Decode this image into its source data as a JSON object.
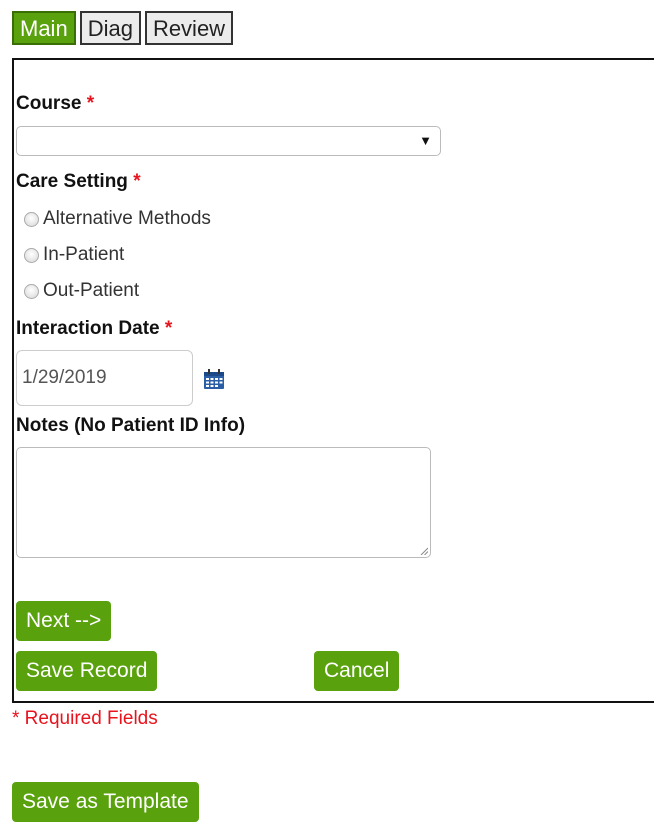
{
  "tabs": [
    {
      "label": "Main",
      "active": true
    },
    {
      "label": "Diag",
      "active": false
    },
    {
      "label": "Review",
      "active": false
    }
  ],
  "form": {
    "course_label": "Course",
    "course_value": "",
    "required_marker": "*",
    "care_setting_label": "Care Setting",
    "care_setting_options": [
      "Alternative Methods",
      "In-Patient",
      "Out-Patient"
    ],
    "interaction_date_label": "Interaction Date",
    "interaction_date_value": "1/29/2019",
    "notes_label": "Notes (No Patient ID Info)",
    "notes_value": ""
  },
  "buttons": {
    "next": "Next -->",
    "save_record": "Save Record",
    "cancel": "Cancel",
    "save_template": "Save as Template"
  },
  "required_note": "* Required Fields",
  "icons": {
    "dropdown": "chevron-down-icon",
    "calendar": "calendar-icon"
  },
  "colors": {
    "accent": "#5aa10e",
    "required": "#e8131c"
  }
}
